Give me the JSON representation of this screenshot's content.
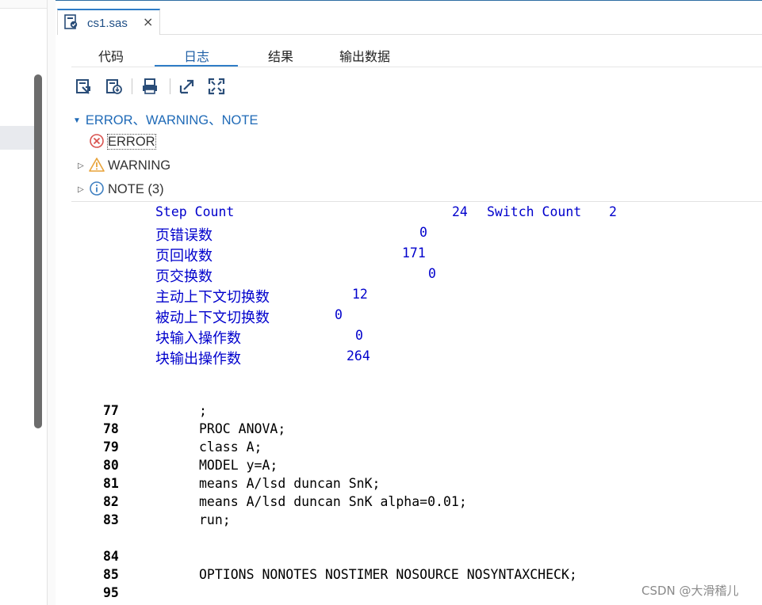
{
  "editor": {
    "tab_title": "cs1.sas",
    "close_glyph": "×"
  },
  "view_tabs": [
    "代码",
    "日志",
    "结果",
    "输出数据"
  ],
  "active_view": "日志",
  "toolbar": [
    "save-log-icon",
    "save-as-icon",
    "print-icon",
    "open-new-window-icon",
    "maximize-icon"
  ],
  "tree": {
    "root": "ERROR、WARNING、NOTE",
    "items": [
      {
        "label": "ERROR",
        "icon": "error-icon"
      },
      {
        "label": "WARNING",
        "icon": "warning-icon"
      },
      {
        "label": "NOTE (3)",
        "icon": "info-icon"
      }
    ]
  },
  "log": {
    "step_count_label": "Step Count",
    "step_count_value": "24",
    "switch_count_label": "Switch Count",
    "switch_count_value": "2",
    "stats": [
      {
        "label": "页错误数",
        "value": "0"
      },
      {
        "label": "页回收数",
        "value": "171"
      },
      {
        "label": "页交换数",
        "value": "0"
      },
      {
        "label": "主动上下文切换数",
        "value": "12"
      },
      {
        "label": "被动上下文切换数",
        "value": "0"
      },
      {
        "label": "块输入操作数",
        "value": "0"
      },
      {
        "label": "块输出操作数",
        "value": "264"
      }
    ]
  },
  "code_lines": [
    {
      "num": "77",
      "text": ";"
    },
    {
      "num": "78",
      "text": "PROC ANOVA;"
    },
    {
      "num": "79",
      "text": "class A;"
    },
    {
      "num": "80",
      "text": "MODEL y=A;"
    },
    {
      "num": "81",
      "text": "means A/lsd duncan SnK;"
    },
    {
      "num": "82",
      "text": "means A/lsd duncan SnK alpha=0.01;"
    },
    {
      "num": "83",
      "text": "run;"
    },
    {
      "num": "84",
      "text": ""
    },
    {
      "num": "85",
      "text": "OPTIONS NONOTES NOSTIMER NOSOURCE NOSYNTAXCHECK;"
    },
    {
      "num": "95",
      "text": ""
    }
  ],
  "watermark": "CSDN @大滑稽儿",
  "colors": {
    "accent": "#2f7dc7",
    "log_blue": "#0000cc",
    "tree_blue": "#1f6ab7"
  }
}
